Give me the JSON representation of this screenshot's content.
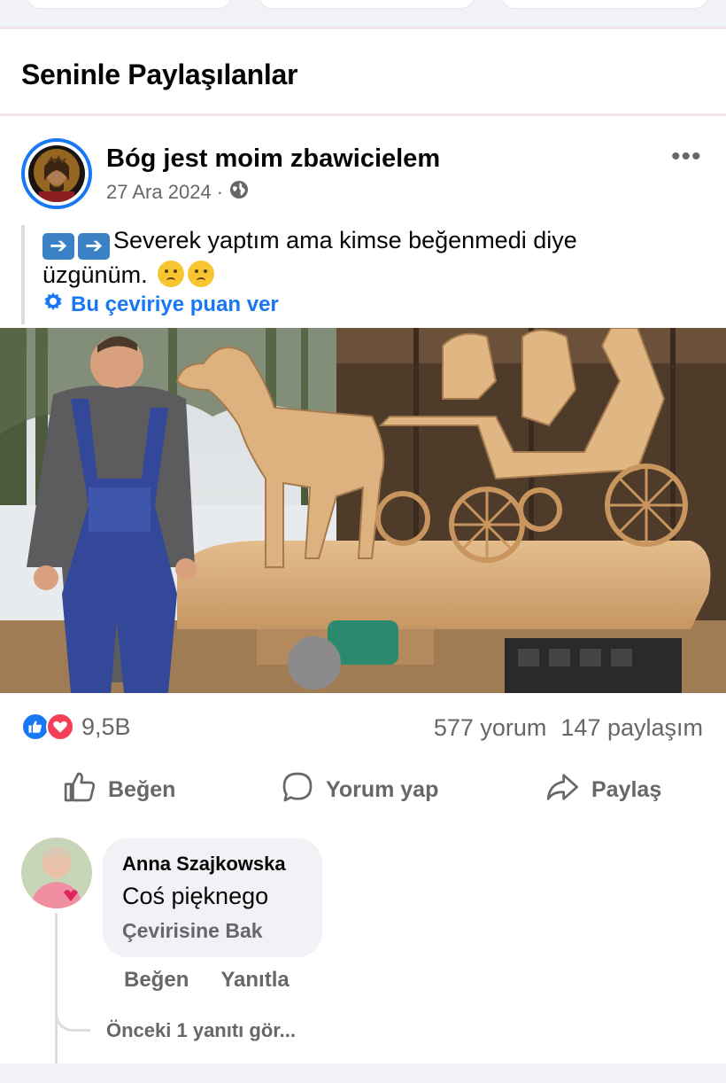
{
  "section": {
    "title": "Seninle Paylaşılanlar"
  },
  "post": {
    "author": "Bóg jest moim zbawicielem",
    "date": "27 Ara 2024",
    "separator": "·",
    "more_label": "•••",
    "text_line1": "Severek yaptım ama kimse beğenmedi diye",
    "text_line2": "üzgünüm.",
    "translate_rate_label": "Bu çeviriye puan ver",
    "image_alt": "Wooden carved horse and carriage sculpture with carver"
  },
  "stats": {
    "reaction_count": "9,5B",
    "comments": "577 yorum",
    "shares": "147 paylaşım"
  },
  "actions": {
    "like": "Beğen",
    "comment": "Yorum yap",
    "share": "Paylaş"
  },
  "comment": {
    "name": "Anna Szajkowska",
    "text": "Coś pięknego",
    "translate": "Çevirisine Bak",
    "like": "Beğen",
    "reply": "Yanıtla",
    "previous_replies": "Önceki 1 yanıtı gör..."
  },
  "colors": {
    "accent": "#1877f2",
    "secondary_text": "#65676b",
    "love": "#f33e58"
  },
  "icons": [
    "globe-icon",
    "gear-icon",
    "like-icon",
    "comment-icon",
    "share-icon",
    "more-icon"
  ]
}
